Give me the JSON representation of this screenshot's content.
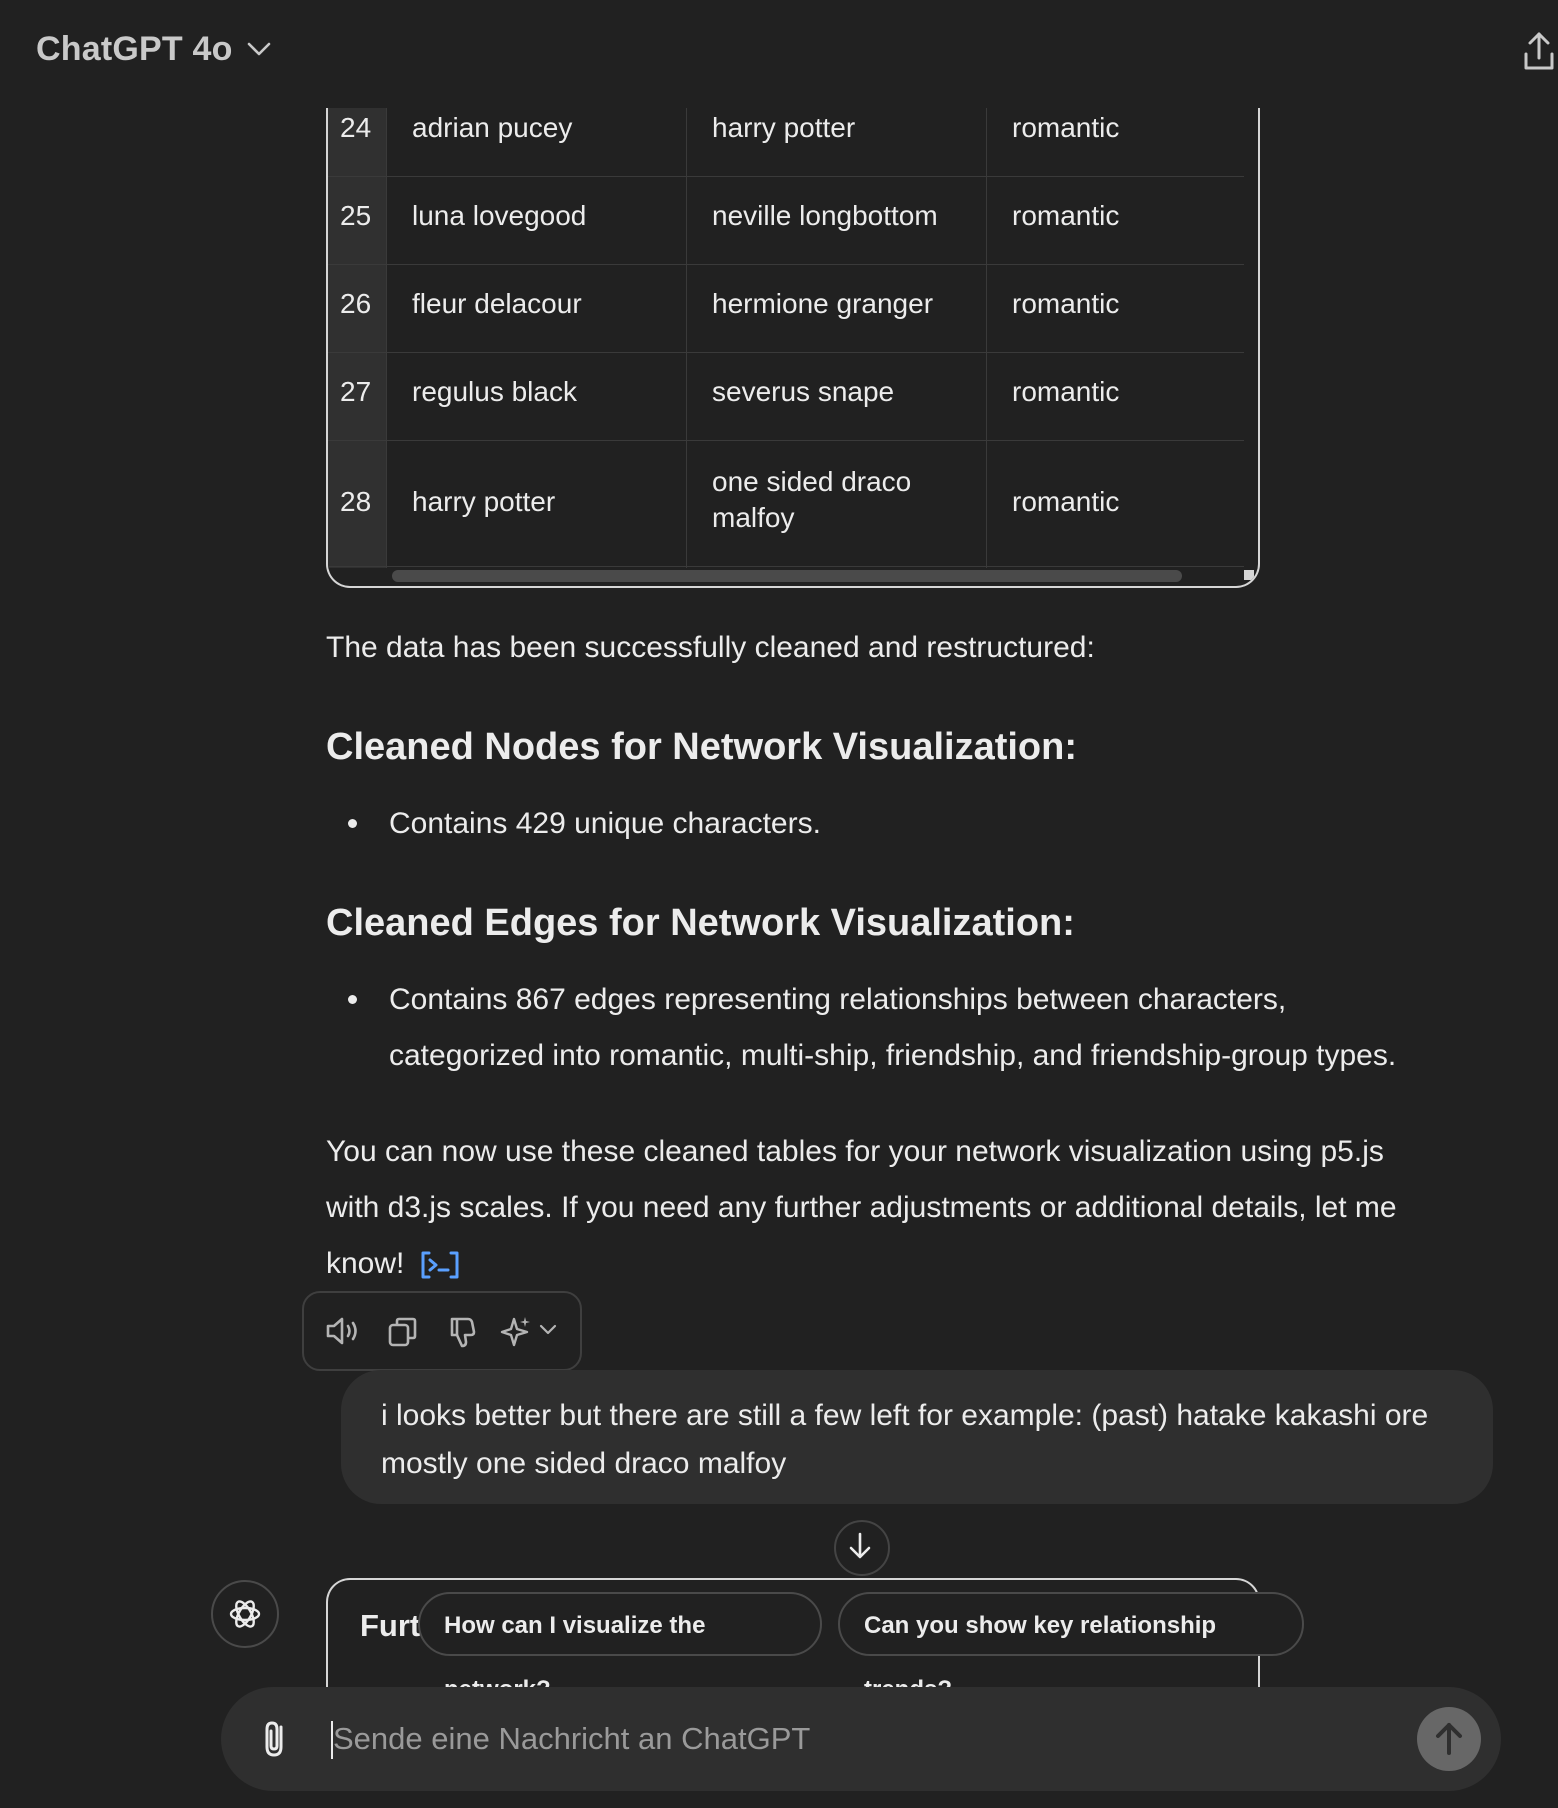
{
  "header": {
    "model_title": "ChatGPT 4o"
  },
  "table": {
    "rows": [
      {
        "num": "24",
        "c1": "adrian pucey",
        "c2": "harry potter",
        "c3": "romantic"
      },
      {
        "num": "25",
        "c1": "luna lovegood",
        "c2": "neville longbottom",
        "c3": "romantic"
      },
      {
        "num": "26",
        "c1": "fleur delacour",
        "c2": "hermione granger",
        "c3": "romantic"
      },
      {
        "num": "27",
        "c1": "regulus black",
        "c2": "severus snape",
        "c3": "romantic"
      },
      {
        "num": "28",
        "c1": "harry potter",
        "c2": "one sided draco\nmalfoy",
        "c3": "romantic"
      }
    ]
  },
  "message": {
    "intro": "The data has been successfully cleaned and restructured:",
    "heading1": "Cleaned Nodes for Network Visualization:",
    "bullet1": "Contains 429 unique characters.",
    "heading2": "Cleaned Edges for Network Visualization:",
    "bullet2_line1": "Contains 867 edges representing relationships between characters,",
    "bullet2_line2": "categorized into romantic, multi-ship, friendship, and friendship-group types.",
    "outro_line1": "You can now use these cleaned tables for your network visualization using p5.js",
    "outro_line2": "with d3.js scales. If you need any further adjustments or additional details, let me",
    "outro_line3": "know!"
  },
  "user_message": "i looks better but there are still a few left for example: (past) hatake kakashi ore mostly one sided draco malfoy",
  "next_table_title": "Furt",
  "suggestions": {
    "s1": "How can I visualize the network?",
    "s2": "Can you show key relationship trends?"
  },
  "composer": {
    "placeholder": "Sende eine Nachricht an ChatGPT"
  },
  "colors": {
    "background": "#212121",
    "bubble": "#2f2f2f",
    "link_blue": "#5aa0ff"
  }
}
